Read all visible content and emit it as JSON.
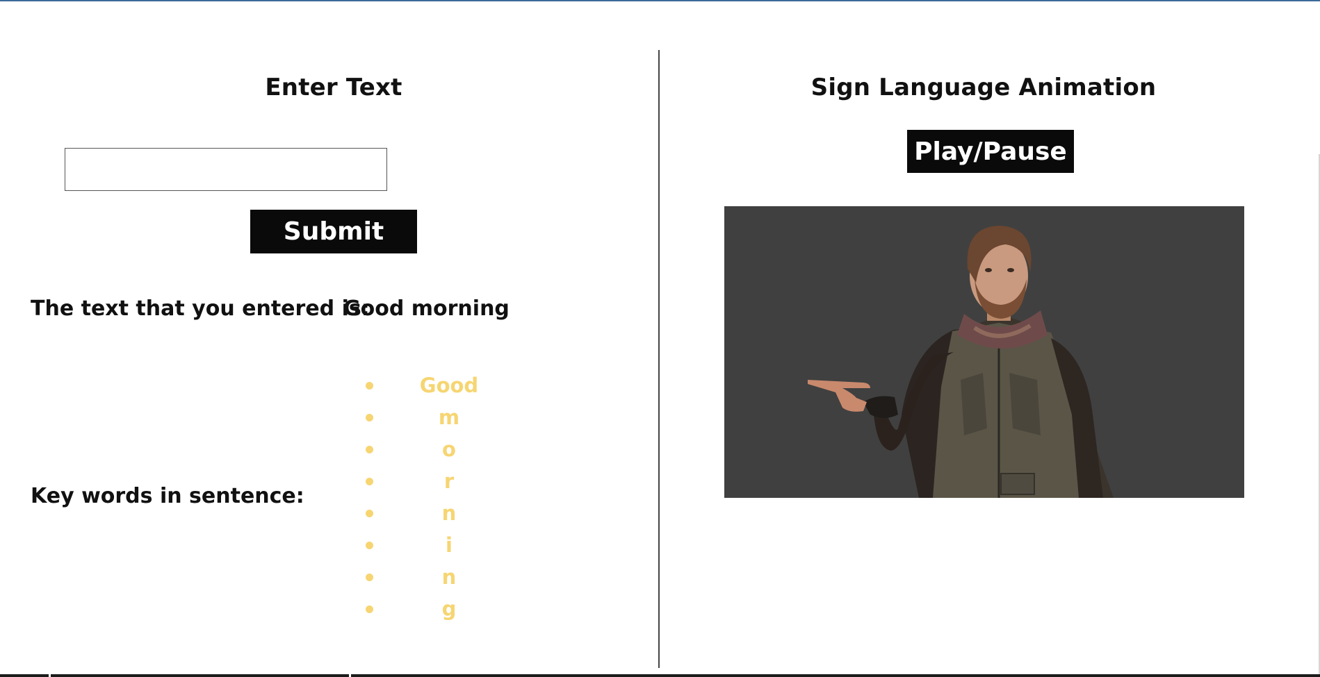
{
  "left": {
    "heading": "Enter Text",
    "input": {
      "value": "",
      "placeholder": ""
    },
    "submit_label": "Submit",
    "entered_label": "The text that you entered is:",
    "entered_value": "Good morning",
    "keywords_label": "Key words in sentence:",
    "keywords": [
      "Good",
      "m",
      "o",
      "r",
      "n",
      "i",
      "n",
      "g"
    ]
  },
  "right": {
    "heading": "Sign Language Animation",
    "play_label": "Play/Pause"
  },
  "colors": {
    "keyword": "#f6d572",
    "button_bg": "#0a0a0a",
    "button_text": "#ffffff",
    "video_bg": "#404040",
    "top_accent": "#3c6a98"
  },
  "icons": {
    "avatar": "signing-avatar-figure"
  }
}
